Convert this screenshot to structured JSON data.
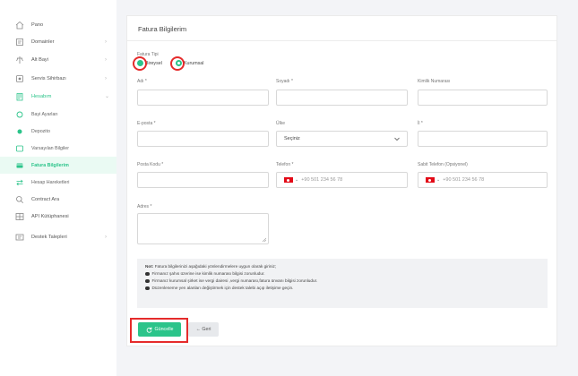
{
  "sidebar": {
    "items": [
      {
        "label": "Pano",
        "icon": "home-icon"
      },
      {
        "label": "Domainler",
        "icon": "domain-icon"
      },
      {
        "label": "Alt Bayi",
        "icon": "sub-dealer-icon"
      },
      {
        "label": "Servis Sihirbazı",
        "icon": "service-wizard-icon"
      },
      {
        "label": "Hesabım",
        "icon": "account-icon"
      },
      {
        "label": "Bayi Ayarları",
        "icon": "settings-icon"
      },
      {
        "label": "Depozito",
        "icon": "deposit-icon"
      },
      {
        "label": "Varsayılan Bilgiler",
        "icon": "default-info-icon"
      },
      {
        "label": "Fatura Bilgilerim",
        "icon": "invoice-icon"
      },
      {
        "label": "Hesap Hareketleri",
        "icon": "transactions-icon"
      },
      {
        "label": "Contract Ara",
        "icon": "search-icon"
      },
      {
        "label": "API Kütüphanesi",
        "icon": "api-icon"
      },
      {
        "label": "Destek Talepleri",
        "icon": "support-icon"
      }
    ],
    "chevron": "›",
    "chevron_down": "⌄"
  },
  "page": {
    "title": "Fatura Bilgilerim"
  },
  "form": {
    "invoice_type_label": "Fatura Tipi",
    "option_individual": "Bireysel",
    "option_corporate": "Kurumsal",
    "first_name_label": "Adı *",
    "last_name_label": "Soyadı *",
    "id_number_label": "Kimlik Numarası",
    "email_label": "E-posta *",
    "country_label": "Ülke",
    "country_value": "Seçiniz",
    "province_label": "İl *",
    "postcode_label": "Posta Kodu *",
    "phone_label": "Telefon *",
    "phone_value": "+90  501 234 56 78",
    "landline_label": "Sabit Telefon (Opsiyonel)",
    "landline_value": "+90  501 234 56 78",
    "address_label": "Adres *"
  },
  "note": {
    "title": "Not:",
    "intro": "Fatura bilgilerinizi aşağıdaki yönlendirmelere uygun olarak giriniz;",
    "lines": [
      "Firmanız şahıs üzerine ise kimlik numarası bilgisi zorunludur.",
      "Firmanız kurumsal şirket ise vergi dairesi ,vergi numarası,fatura ünvanı bilgisi zorunludur.",
      "Düzenleneme yen alanları değiştirmek için destek talebi açıp iletişime geçin."
    ]
  },
  "buttons": {
    "update": "Güncelle",
    "back": "← Geri"
  },
  "colors": {
    "accent": "#2bc48a",
    "highlight": "#e52b2b"
  }
}
